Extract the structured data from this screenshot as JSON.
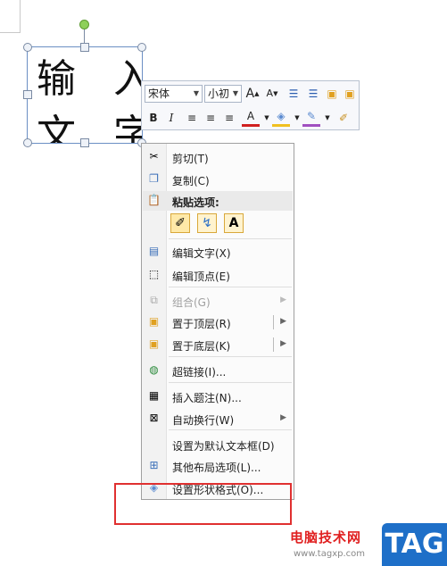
{
  "textbox": {
    "line1": "输 入",
    "line2": "文 字"
  },
  "mini_toolbar": {
    "font_name": "宋体",
    "font_size": "小初",
    "grow_font": "A",
    "shrink_font": "A",
    "bold": "B",
    "italic": "I",
    "font_color": "A",
    "font_color_hex": "#d02020"
  },
  "menu": {
    "cut": "剪切(T)",
    "copy": "复制(C)",
    "paste_header": "粘贴选项:",
    "paste_text_only": "A",
    "edit_text": "编辑文字(X)",
    "edit_points": "编辑顶点(E)",
    "group": "组合(G)",
    "bring_to_front": "置于顶层(R)",
    "send_to_back": "置于底层(K)",
    "hyperlink": "超链接(I)...",
    "insert_caption": "插入题注(N)...",
    "wrap_text": "自动换行(W)",
    "set_default_textbox": "设置为默认文本框(D)",
    "more_layout": "其他布局选项(L)...",
    "format_shape": "设置形状格式(O)..."
  },
  "watermark": {
    "title": "电脑技术网",
    "url": "www.tagxp.com",
    "tag": "TAG"
  },
  "colors": {
    "highlight_border": "#e03030",
    "menu_border": "#a0a0a0"
  }
}
